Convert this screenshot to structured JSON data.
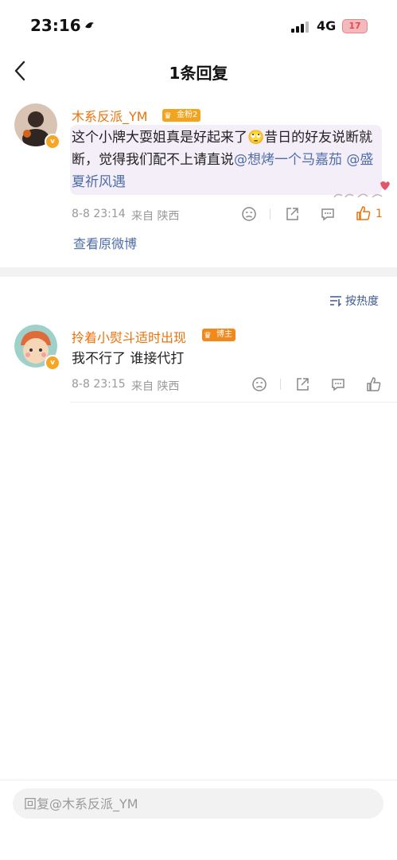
{
  "status_bar": {
    "time": "23:16",
    "network": "4G",
    "battery": "17"
  },
  "nav": {
    "title": "1条回复",
    "back_icon": "chevron-left-icon"
  },
  "parent_comment": {
    "username": "木系反派_YM",
    "fan_badge": "金粉2",
    "text_before_emoji": "这个小牌大耍姐真是好起来了",
    "emoji": "🙄",
    "text_after_emoji": "昔日的好友说断就断，觉得我们配不上请直说",
    "mention1": "@想烤一个马嘉茄",
    "mention2": "@盛夏祈风遇",
    "time": "8-8 23:14",
    "source": "来自 陕西",
    "like_count": "1",
    "view_original": "查看原微博"
  },
  "sort": {
    "label": "按热度"
  },
  "reply": {
    "username": "拎着小熨斗适时出现",
    "role_badge": "博主",
    "text": "我不行了 谁接代打",
    "time": "8-8 23:15",
    "source": "来自 陕西"
  },
  "composer": {
    "placeholder": "回复@木系反派_YM"
  },
  "colors": {
    "username": "#e8730d",
    "mention": "#4f6ea8",
    "badge": "#f3a41f",
    "highlight": "#f4eef9"
  }
}
